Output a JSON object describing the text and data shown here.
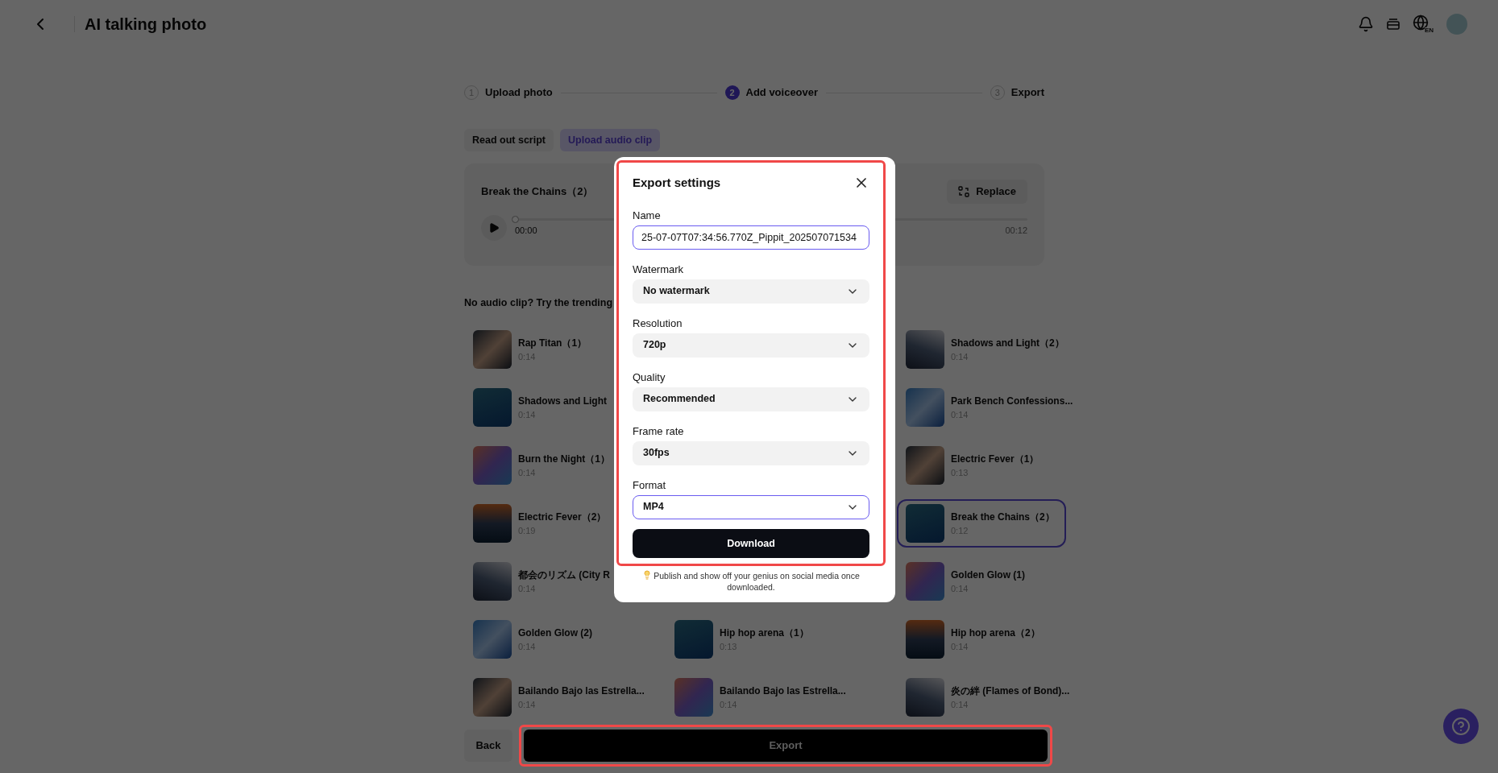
{
  "header": {
    "title": "AI talking photo",
    "language": "EN"
  },
  "steps": [
    {
      "number": "1",
      "label": "Upload photo",
      "selected": false
    },
    {
      "number": "2",
      "label": "Add voiceover",
      "selected": true
    },
    {
      "number": "3",
      "label": "Export",
      "selected": false
    }
  ],
  "tabs": [
    {
      "label": "Read out script",
      "selected": false
    },
    {
      "label": "Upload audio clip",
      "selected": true
    }
  ],
  "audio": {
    "title": "Break the Chains（2）",
    "replace": "Replace",
    "current": "00:00",
    "total": "00:12",
    "level": 0
  },
  "trending": {
    "heading": "No audio clip? Try the trending",
    "rows": [
      {
        "left": {
          "title": "Rap Titan（1）",
          "duration": "0:14",
          "selected": false
        },
        "right": {
          "title": "Shadows and Light（2）",
          "duration": "0:14",
          "selected": false
        }
      },
      {
        "left": {
          "title": "Shadows and Light",
          "duration": "0:14",
          "selected": false
        },
        "right": {
          "title": "Park Bench Confessions...",
          "duration": "0:14",
          "selected": false
        }
      },
      {
        "left": {
          "title": "Burn the Night（1）",
          "duration": "0:14",
          "selected": false
        },
        "right": {
          "title": "Electric Fever（1）",
          "duration": "0:13",
          "selected": false
        }
      },
      {
        "left": {
          "title": "Electric Fever（2）",
          "duration": "0:19",
          "selected": false
        },
        "right": {
          "title": "Break the Chains（2）",
          "duration": "0:12",
          "selected": true
        }
      },
      {
        "left": {
          "title": "都会のリズム (City R",
          "duration": "0:14",
          "selected": false
        },
        "right": {
          "title": "Golden Glow (1)",
          "duration": "0:14",
          "selected": false
        }
      },
      {
        "left": {
          "title": "Golden Glow (2)",
          "duration": "0:14",
          "selected": false
        },
        "middle": {
          "title": "Hip hop arena（1）",
          "duration": "0:13",
          "selected": false
        },
        "right": {
          "title": "Hip hop arena（2）",
          "duration": "0:14",
          "selected": false
        }
      },
      {
        "left": {
          "title": "Bailando Bajo las Estrella...",
          "duration": "0:14",
          "selected": false
        },
        "middle": {
          "title": "Bailando Bajo las Estrella...",
          "duration": "0:14",
          "selected": false
        },
        "right": {
          "title": "炎の絆 (Flames of Bond)...",
          "duration": "0:14",
          "selected": false
        }
      }
    ]
  },
  "bottom": {
    "back": "Back",
    "export": "Export"
  },
  "dialog": {
    "title": "Export settings",
    "fields": [
      {
        "kind": "text",
        "label": "Name",
        "value": "25-07-07T07:34:56.770Z_Pippit_202507071534",
        "focused": true
      },
      {
        "kind": "select",
        "label": "Watermark",
        "value": "No watermark",
        "focused": false
      },
      {
        "kind": "select",
        "label": "Resolution",
        "value": "720p",
        "focused": false
      },
      {
        "kind": "select",
        "label": "Quality",
        "value": "Recommended",
        "focused": false
      },
      {
        "kind": "select",
        "label": "Frame rate",
        "value": "30fps",
        "focused": false
      },
      {
        "kind": "select",
        "label": "Format",
        "value": "MP4",
        "focused": true
      }
    ],
    "download": "Download",
    "tip": "Publish and show off your genius on social media once downloaded."
  }
}
